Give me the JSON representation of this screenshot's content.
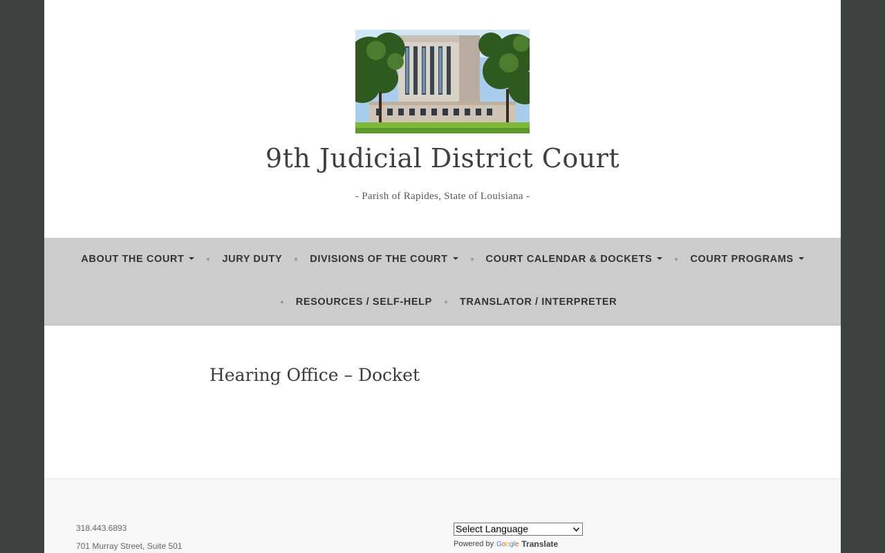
{
  "site": {
    "title": "9th Judicial District Court",
    "tagline": "- Parish of Rapides, State of Louisiana -"
  },
  "nav": {
    "row1": [
      {
        "label": "ABOUT THE COURT",
        "dropdown": true
      },
      {
        "label": "JURY DUTY",
        "dropdown": false
      },
      {
        "label": "DIVISIONS OF THE COURT",
        "dropdown": true
      },
      {
        "label": "COURT CALENDAR & DOCKETS",
        "dropdown": true
      },
      {
        "label": "COURT PROGRAMS",
        "dropdown": true
      }
    ],
    "row2": [
      {
        "label": "RESOURCES / SELF-HELP",
        "dropdown": false
      },
      {
        "label": "TRANSLATOR / INTERPRETER",
        "dropdown": false
      }
    ]
  },
  "page": {
    "title": "Hearing Office – Docket"
  },
  "footer": {
    "phone": "318.443.6893",
    "address": "701 Murray Street, Suite 501",
    "translate": {
      "select_value": "Select Language",
      "powered_by": "Powered by",
      "google": "Google",
      "translate_label": "Translate"
    }
  },
  "colors": {
    "outer_background": "#3d4140",
    "nav_background": "#cccccc",
    "footer_background": "#f8f8f8",
    "text_dark": "#333333"
  },
  "icons": {
    "dropdown": "caret-down-icon",
    "separator": "bullet-dot"
  }
}
